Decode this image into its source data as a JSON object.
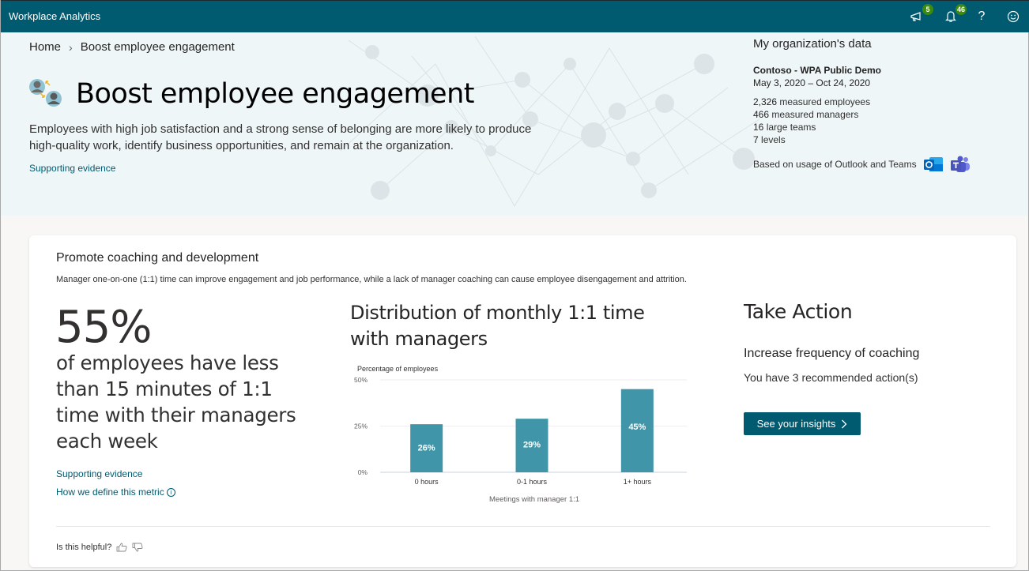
{
  "app": {
    "title": "Workplace Analytics",
    "toolbar": [
      {
        "icon": "megaphone-icon",
        "badge": "5"
      },
      {
        "icon": "bell-icon",
        "badge": "46"
      },
      {
        "icon": "help-icon",
        "symbol": "?"
      },
      {
        "icon": "smiley-feedback-icon"
      }
    ]
  },
  "breadcrumb": {
    "home": "Home",
    "separator": "›",
    "current": "Boost employee engagement"
  },
  "hero": {
    "title": "Boost employee engagement",
    "description": "Employees with high job satisfaction and a strong sense of belonging are more likely to produce high-quality work, identify business opportunities, and remain at the organization.",
    "supporting_link": "Supporting evidence"
  },
  "org": {
    "heading": "My organization's data",
    "name": "Contoso - WPA Public Demo",
    "dates": "May 3, 2020 – Oct 24, 2020",
    "stats": [
      {
        "value": "2,326",
        "label": "measured employees"
      },
      {
        "value": "466",
        "label": "measured managers"
      },
      {
        "value": "16",
        "label": "large teams"
      },
      {
        "value": "7",
        "label": "levels"
      }
    ],
    "based_on": "Based on usage of Outlook and Teams",
    "apps": [
      "outlook-icon",
      "teams-icon"
    ]
  },
  "card": {
    "title": "Promote coaching and development",
    "subtitle": "Manager one-on-one (1:1) time can improve engagement and job performance, while a lack of manager coaching can cause employee disengagement and attrition.",
    "metric": {
      "value": "55%",
      "description": "of employees have less than 15 minutes of 1:1 time with their managers each week"
    },
    "links": {
      "supporting": "Supporting evidence",
      "define": "How we define this metric"
    },
    "chart_title": "Distribution of monthly 1:1 time with managers",
    "action": {
      "title": "Take Action",
      "subtitle": "Increase frequency of coaching",
      "count_text": "You have 3 recommended action(s)",
      "button": "See your insights"
    },
    "feedback": "Is this helpful?"
  },
  "colors": {
    "brand": "#005a70",
    "bar": "#4096a8",
    "badge": "#3c8a0e"
  },
  "chart_data": {
    "type": "bar",
    "title": "Distribution of monthly 1:1 time with managers",
    "ylabel": "Percentage of employees",
    "xlabel": "Meetings with manager 1:1",
    "categories": [
      "0 hours",
      "0-1 hours",
      "1+ hours"
    ],
    "values": [
      26,
      29,
      45
    ],
    "data_labels": [
      "26%",
      "29%",
      "45%"
    ],
    "yticks": [
      "0%",
      "25%",
      "50%"
    ],
    "ytick_values": [
      0,
      25,
      50
    ],
    "ylim": [
      0,
      50
    ],
    "grid": true
  }
}
